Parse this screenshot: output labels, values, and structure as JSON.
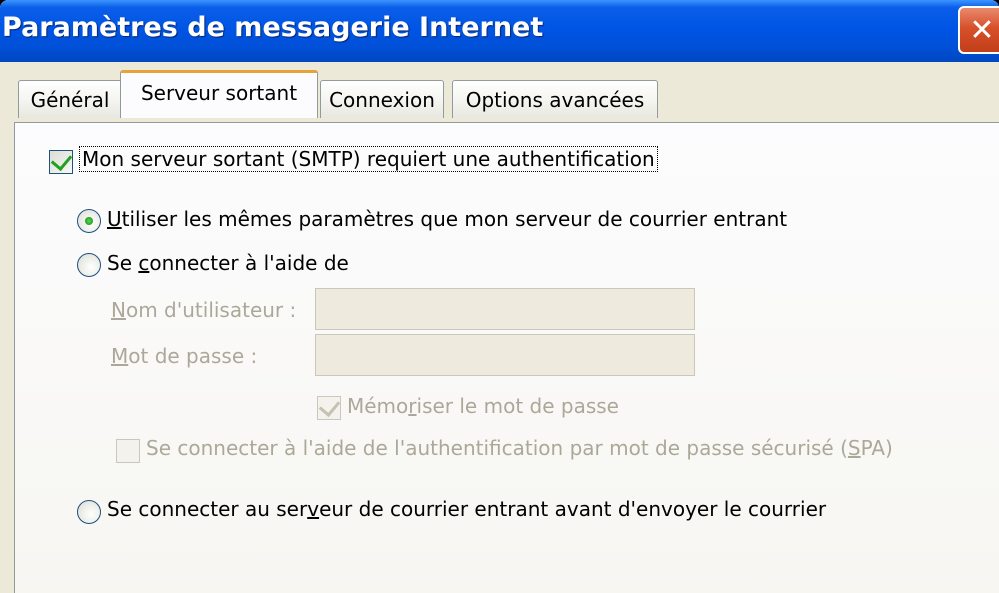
{
  "window": {
    "title": "Paramètres de messagerie Internet",
    "close_glyph": "✕"
  },
  "tabs": [
    {
      "label": "Général",
      "active": false
    },
    {
      "label": "Serveur sortant",
      "active": true
    },
    {
      "label": "Connexion",
      "active": false
    },
    {
      "label": "Options avancées",
      "active": false
    }
  ],
  "smtp_auth": {
    "checked": true,
    "label": "Mon serveur sortant (SMTP) requiert une authentification"
  },
  "options": {
    "same_settings": {
      "label_pre": "",
      "label_u": "U",
      "label_post": "tiliser les mêmes paramètres que mon serveur de courrier entrant",
      "selected": true
    },
    "log_on_using": {
      "label_pre": "Se ",
      "label_u": "c",
      "label_post": "onnecter à l'aide de",
      "selected": false
    },
    "username": {
      "label_pre": "",
      "label_u": "N",
      "label_post": "om d'utilisateur :",
      "value": ""
    },
    "password": {
      "label_pre": "",
      "label_u": "M",
      "label_post": "ot de passe :",
      "value": ""
    },
    "remember_password": {
      "label_pre": "Mémo",
      "label_u": "r",
      "label_post": "iser le mot de passe",
      "checked": true,
      "disabled": true
    },
    "spa": {
      "label_pre": "Se connecter à l'aide de l'authentification par mot de passe sécurisé (",
      "label_u": "S",
      "label_post": "PA)",
      "checked": false,
      "disabled": true
    },
    "log_on_before": {
      "label_pre": "Se connecter au ser",
      "label_u": "v",
      "label_post": "eur de courrier entrant avant d'envoyer le courrier",
      "selected": false
    }
  },
  "colors": {
    "titlebar": "#0055E5",
    "dialog_bg": "#ECE9D8",
    "active_tab_accent": "#E6A33A",
    "check_green": "#21A121",
    "disabled_text": "#ACA899"
  }
}
